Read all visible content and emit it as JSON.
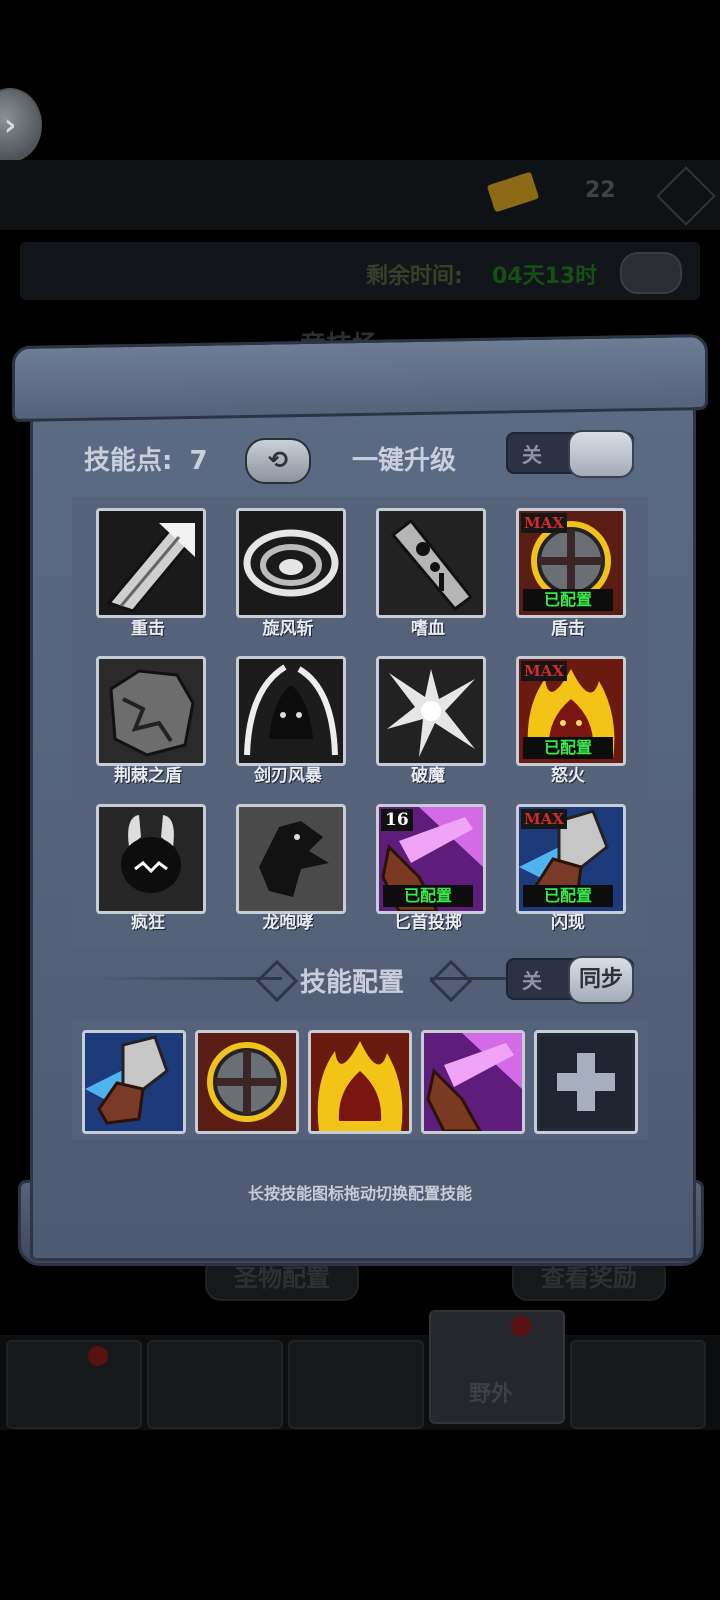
{
  "background": {
    "ticket_count": "22",
    "timer_label": "剩余时间:",
    "timer_value": "04天13时",
    "arena_title": "竞技场",
    "lower_left_button": "圣物配置",
    "lower_right_button": "查看奖励",
    "nav_active_label": "野外"
  },
  "panel": {
    "skill_points_label": "技能点:",
    "skill_points_value": "7",
    "one_key_upgrade_label": "一键升级",
    "one_key_toggle_off": "关",
    "skills": [
      {
        "name": "重击",
        "icon": "heavy-strike-icon"
      },
      {
        "name": "旋风斩",
        "icon": "whirlwind-icon"
      },
      {
        "name": "嗜血",
        "icon": "bloodthirst-icon"
      },
      {
        "name": "盾击",
        "icon": "shield-bash-icon",
        "badge": "MAX",
        "status": "已配置"
      },
      {
        "name": "荆棘之盾",
        "icon": "thorn-shield-icon"
      },
      {
        "name": "剑刃风暴",
        "icon": "bladestorm-icon"
      },
      {
        "name": "破魔",
        "icon": "spell-break-icon"
      },
      {
        "name": "怒火",
        "icon": "fury-icon",
        "badge": "MAX",
        "status": "已配置"
      },
      {
        "name": "疯狂",
        "icon": "frenzy-icon"
      },
      {
        "name": "龙咆哮",
        "icon": "dragon-roar-icon"
      },
      {
        "name": "匕首投掷",
        "icon": "dagger-throw-icon",
        "badge": "16",
        "status": "已配置"
      },
      {
        "name": "闪现",
        "icon": "blink-icon",
        "badge": "MAX",
        "status": "已配置"
      }
    ],
    "config_title": "技能配置",
    "sync_toggle_off": "关",
    "sync_toggle_label": "同步",
    "hint": "长按技能图标拖动切换配置技能"
  }
}
